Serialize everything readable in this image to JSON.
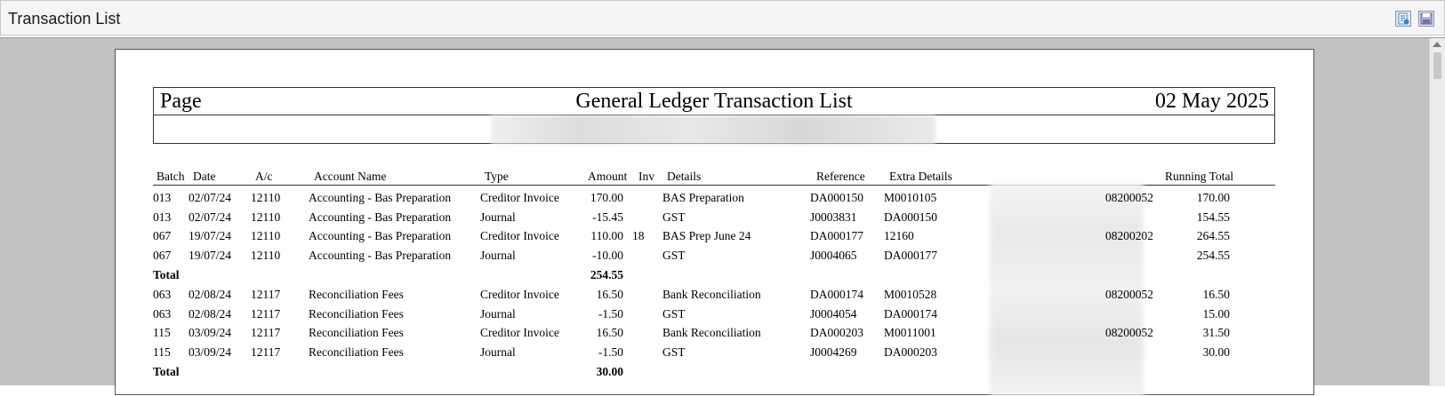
{
  "window": {
    "title": "Transaction List",
    "icons": [
      "export-icon",
      "save-icon"
    ]
  },
  "report": {
    "page_label": "Page",
    "title": "General Ledger Transaction List",
    "date": "02 May 2025",
    "columns": {
      "batch": "Batch",
      "date": "Date",
      "ac": "A/c",
      "account_name": "Account Name",
      "type": "Type",
      "amount": "Amount",
      "inv": "Inv",
      "details": "Details",
      "reference": "Reference",
      "extra_details": "Extra Details",
      "running_total": "Running Total"
    },
    "rows": [
      {
        "kind": "txn",
        "batch": "013",
        "date": "02/07/24",
        "ac": "12110",
        "account_name": "Accounting - Bas Preparation",
        "type": "Creditor Invoice",
        "amount": "170.00",
        "inv": "",
        "details": "BAS Preparation",
        "reference": "DA000150",
        "extra": "M0010105",
        "code": "08200052",
        "running": "170.00"
      },
      {
        "kind": "txn",
        "batch": "013",
        "date": "02/07/24",
        "ac": "12110",
        "account_name": "Accounting - Bas Preparation",
        "type": "Journal",
        "amount": "-15.45",
        "inv": "",
        "details": "GST",
        "reference": "J0003831",
        "extra": "DA000150",
        "code": "",
        "running": "154.55"
      },
      {
        "kind": "txn",
        "batch": "067",
        "date": "19/07/24",
        "ac": "12110",
        "account_name": "Accounting - Bas Preparation",
        "type": "Creditor Invoice",
        "amount": "110.00",
        "inv": "18",
        "details": "BAS Prep June 24",
        "reference": "DA000177",
        "extra": "12160",
        "code": "08200202",
        "running": "264.55"
      },
      {
        "kind": "txn",
        "batch": "067",
        "date": "19/07/24",
        "ac": "12110",
        "account_name": "Accounting - Bas Preparation",
        "type": "Journal",
        "amount": "-10.00",
        "inv": "",
        "details": "GST",
        "reference": "J0004065",
        "extra": "DA000177",
        "code": "",
        "running": "254.55"
      },
      {
        "kind": "total",
        "label": "Total",
        "amount": "254.55"
      },
      {
        "kind": "txn",
        "batch": "063",
        "date": "02/08/24",
        "ac": "12117",
        "account_name": "Reconciliation Fees",
        "type": "Creditor Invoice",
        "amount": "16.50",
        "inv": "",
        "details": "Bank Reconciliation",
        "reference": "DA000174",
        "extra": "M0010528",
        "code": "08200052",
        "running": "16.50"
      },
      {
        "kind": "txn",
        "batch": "063",
        "date": "02/08/24",
        "ac": "12117",
        "account_name": "Reconciliation Fees",
        "type": "Journal",
        "amount": "-1.50",
        "inv": "",
        "details": "GST",
        "reference": "J0004054",
        "extra": "DA000174",
        "code": "",
        "running": "15.00"
      },
      {
        "kind": "txn",
        "batch": "115",
        "date": "03/09/24",
        "ac": "12117",
        "account_name": "Reconciliation Fees",
        "type": "Creditor Invoice",
        "amount": "16.50",
        "inv": "",
        "details": "Bank Reconciliation",
        "reference": "DA000203",
        "extra": "M0011001",
        "code": "08200052",
        "running": "31.50"
      },
      {
        "kind": "txn",
        "batch": "115",
        "date": "03/09/24",
        "ac": "12117",
        "account_name": "Reconciliation Fees",
        "type": "Journal",
        "amount": "-1.50",
        "inv": "",
        "details": "GST",
        "reference": "J0004269",
        "extra": "DA000203",
        "code": "",
        "running": "30.00"
      },
      {
        "kind": "total",
        "label": "Total",
        "amount": "30.00"
      }
    ]
  }
}
